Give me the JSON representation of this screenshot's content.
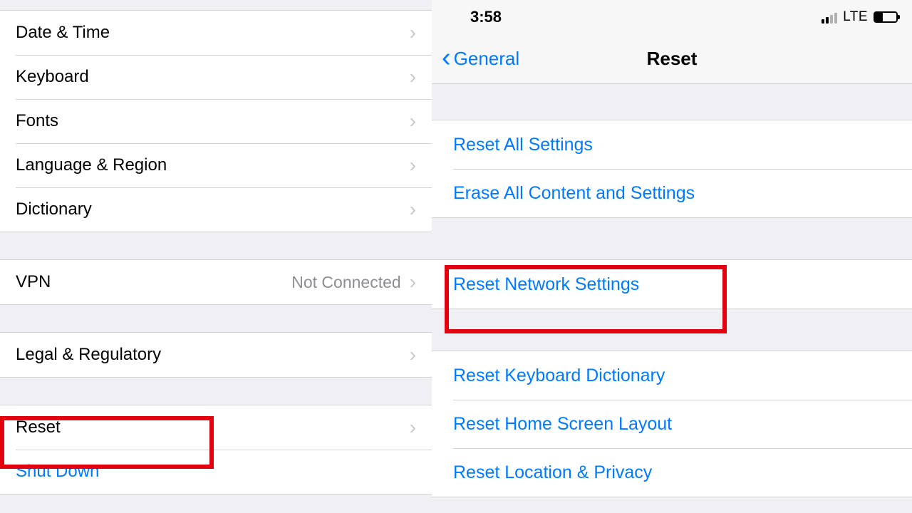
{
  "left": {
    "group1": [
      "Date & Time",
      "Keyboard",
      "Fonts",
      "Language & Region",
      "Dictionary"
    ],
    "vpn": {
      "label": "VPN",
      "value": "Not Connected"
    },
    "legal": "Legal & Regulatory",
    "reset": "Reset",
    "shutdown": "Shut Down"
  },
  "right": {
    "status": {
      "time": "3:58",
      "net": "LTE"
    },
    "nav": {
      "back": "General",
      "title": "Reset"
    },
    "group1": [
      "Reset All Settings",
      "Erase All Content and Settings"
    ],
    "group2": [
      "Reset Network Settings"
    ],
    "group3": [
      "Reset Keyboard Dictionary",
      "Reset Home Screen Layout",
      "Reset Location & Privacy"
    ]
  }
}
